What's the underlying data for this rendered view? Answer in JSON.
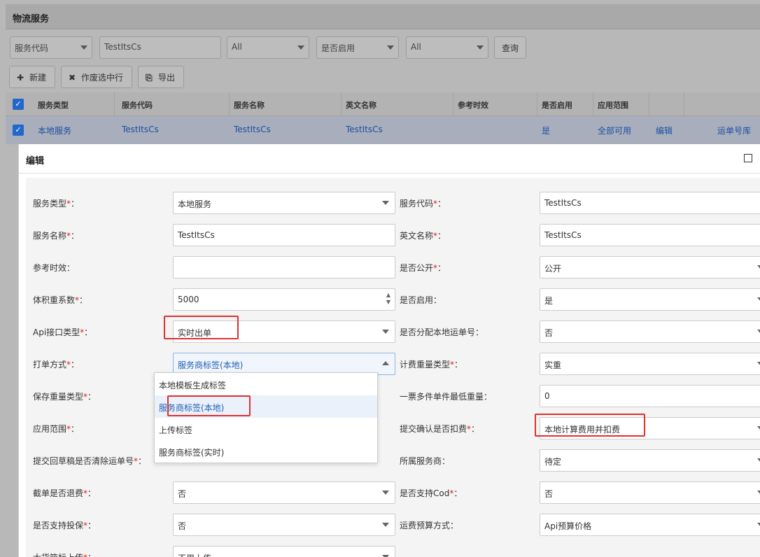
{
  "panel": {
    "title": "物流服务"
  },
  "filters": {
    "field1": "服务代码",
    "field1_value": "TestItsCs",
    "field2": "All",
    "field3": "是否启用",
    "field4": "All",
    "query_label": "查询"
  },
  "toolbar": {
    "new_label": "新建",
    "void_label": "作废选中行",
    "export_label": "导出"
  },
  "grid": {
    "headers": [
      "服务类型",
      "服务代码",
      "服务名称",
      "英文名称",
      "参考时效",
      "是否启用",
      "应用范围"
    ],
    "row": {
      "service_type": "本地服务",
      "service_code": "TestItsCs",
      "service_name": "TestItsCs",
      "english_name": "TestItsCs",
      "enabled": "是",
      "scope": "全部可用",
      "edit": "编辑",
      "waybill": "运单号库"
    }
  },
  "modal": {
    "title": "编辑",
    "left": [
      {
        "label": "服务类型",
        "required": "*",
        "value": "本地服务",
        "kind": "select"
      },
      {
        "label": "服务名称",
        "required": "*",
        "value": "TestItsCs",
        "kind": "text"
      },
      {
        "label": "参考时效",
        "required": "",
        "value": "",
        "kind": "text"
      },
      {
        "label": "体积重系数",
        "required": "*",
        "value": "5000",
        "kind": "number"
      },
      {
        "label": "Api接口类型",
        "required": "*",
        "value": "实时出单",
        "kind": "select"
      },
      {
        "label": "打单方式",
        "required": "*",
        "value": "服务商标签(本地)",
        "kind": "select-open"
      },
      {
        "label": "保存重量类型",
        "required": "*",
        "value": "",
        "kind": "hidden"
      },
      {
        "label": "应用范围",
        "required": "*",
        "value": "",
        "kind": "hidden"
      },
      {
        "label": "提交回草稿是否清除运单号",
        "required": "*",
        "value": "",
        "kind": "hidden"
      },
      {
        "label": "截单是否退费",
        "required": "*",
        "value": "否",
        "kind": "select"
      },
      {
        "label": "是否支持投保",
        "required": "*",
        "value": "否",
        "kind": "select"
      },
      {
        "label": "大货箱标上传",
        "required": "*",
        "value": "不用上传",
        "kind": "select"
      }
    ],
    "right": [
      {
        "label": "服务代码",
        "required": "*",
        "value": "TestItsCs",
        "kind": "text"
      },
      {
        "label": "英文名称",
        "required": "*",
        "value": "TestItsCs",
        "kind": "text"
      },
      {
        "label": "是否公开",
        "required": "*",
        "value": "公开",
        "kind": "select"
      },
      {
        "label": "是否启用",
        "required": "",
        "value": "是",
        "kind": "select"
      },
      {
        "label": "是否分配本地运单号",
        "required": "",
        "value": "否",
        "kind": "select"
      },
      {
        "label": "计费重量类型",
        "required": "*",
        "value": "实重",
        "kind": "select"
      },
      {
        "label": "一票多件单件最低重量",
        "required": "",
        "value": "0",
        "kind": "text"
      },
      {
        "label": "提交确认是否扣费",
        "required": "*",
        "value": "本地计算费用并扣费",
        "kind": "select"
      },
      {
        "label": "所属服务商",
        "required": "",
        "value": "待定",
        "kind": "select"
      },
      {
        "label": "是否支持Cod",
        "required": "*",
        "value": "否",
        "kind": "select"
      },
      {
        "label": "运费预算方式",
        "required": "",
        "value": "Api预算价格",
        "kind": "select"
      }
    ],
    "dropdown_options": [
      "本地模板生成标签",
      "服务商标签(本地)",
      "上传标签",
      "服务商标签(实时)"
    ],
    "label_suffix": "："
  }
}
